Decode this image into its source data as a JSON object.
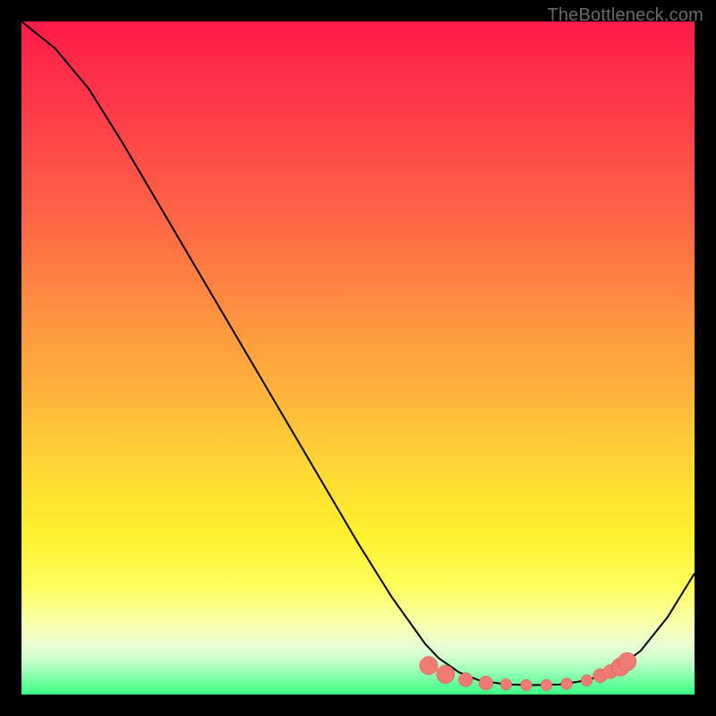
{
  "attribution": "TheBottleneck.com",
  "chart_data": {
    "type": "line",
    "title": "",
    "xlabel": "",
    "ylabel": "",
    "xlim": [
      0,
      100
    ],
    "ylim": [
      0,
      100
    ],
    "grid": false,
    "series": [
      {
        "name": "curve",
        "x": [
          0,
          5,
          10,
          15,
          20,
          25,
          30,
          35,
          40,
          45,
          50,
          55,
          60,
          62,
          65,
          68,
          72,
          76,
          80,
          84,
          88,
          92,
          96,
          100
        ],
        "values": [
          100,
          96,
          90,
          82,
          73.5,
          65,
          56.5,
          48,
          39.5,
          31,
          22.5,
          14.5,
          7.5,
          5.4,
          3.3,
          2.1,
          1.5,
          1.4,
          1.5,
          2.1,
          3.5,
          6.5,
          11.5,
          18
        ]
      },
      {
        "name": "markers",
        "x": [
          60.5,
          63,
          66,
          69,
          72,
          75,
          78,
          81,
          84,
          86,
          87.5,
          89,
          90
        ],
        "values": [
          4.3,
          3.0,
          2.2,
          1.7,
          1.5,
          1.4,
          1.4,
          1.6,
          2.1,
          2.8,
          3.4,
          4.1,
          4.9
        ]
      }
    ],
    "colors": {
      "curve": "#000000",
      "markers_fill": "#ef7b73",
      "markers_stroke": "#c9554d"
    },
    "background_gradient": {
      "top": "#ff1a4a",
      "mid": "#ffd934",
      "bottom": "#3cff84"
    }
  }
}
